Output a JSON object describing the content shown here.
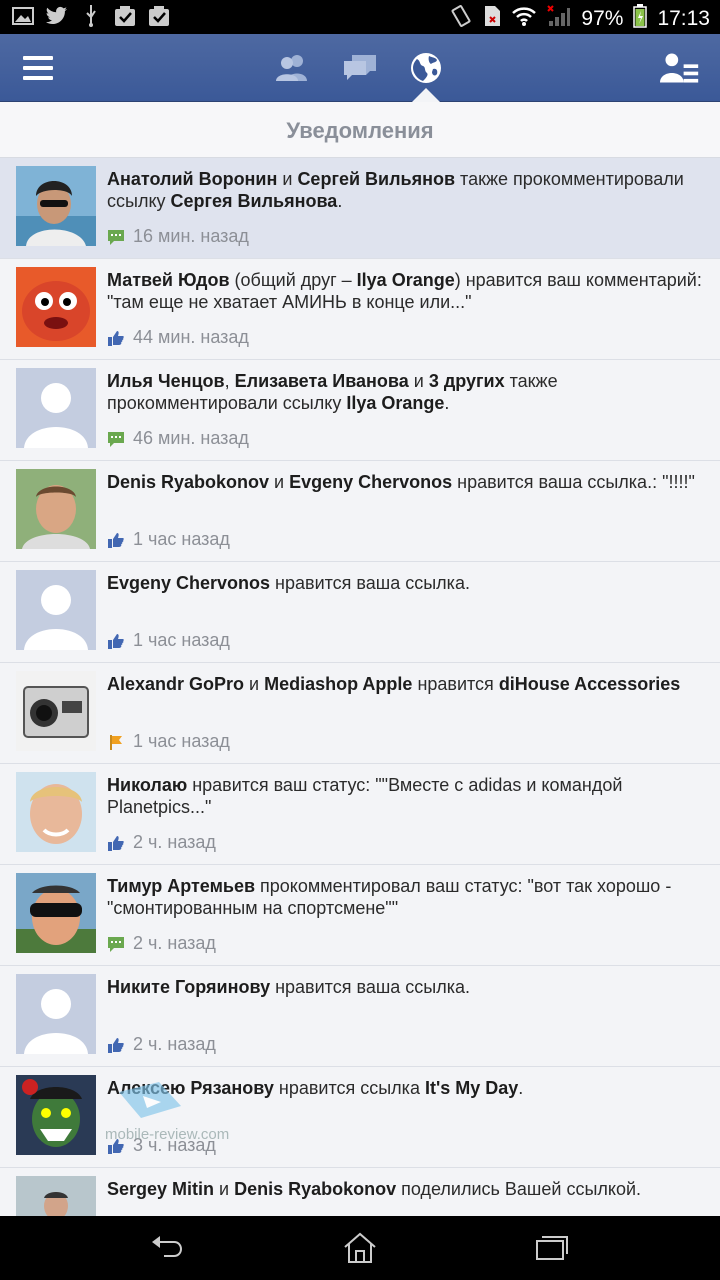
{
  "status_bar": {
    "battery": "97%",
    "time": "17:13"
  },
  "header": {
    "icons": [
      "menu-icon",
      "friends-icon",
      "messages-icon",
      "globe-icon",
      "profile-list-icon"
    ]
  },
  "panel": {
    "title": "Уведомления"
  },
  "notifications": [
    {
      "t1": "Анатолий Воронин",
      "t2": " и ",
      "t3": "Сергей Вильянов",
      "t4": " также прокомментировали ссылку ",
      "t5": "Сергея Вильянова",
      "t6": ".",
      "time": "16 мин. назад",
      "icon": "comment"
    },
    {
      "t1": "Матвей Юдов",
      "t2": " (общий друг – ",
      "t3": "Ilya Orange",
      "t4": ") нравится ваш комментарий: \"там еще не хватает АМИНЬ в конце или...\"",
      "t5": "",
      "t6": "",
      "time": "44 мин. назад",
      "icon": "like"
    },
    {
      "t1": "Илья Ченцов",
      "t2": ", ",
      "t3": "Елизавета Иванова",
      "t4": " и ",
      "t5": "3 других",
      "t6": " также прокомментировали ссылку ",
      "t7": "Ilya Orange",
      "t8": ".",
      "time": "46 мин. назад",
      "icon": "comment"
    },
    {
      "t1": "Denis Ryabokonov",
      "t2": " и ",
      "t3": "Evgeny Chervonos",
      "t4": " нравится ваша ссылка.: \"!!!!\"",
      "t5": "",
      "t6": "",
      "time": "1 час назад",
      "icon": "like"
    },
    {
      "t1": "Evgeny Chervonos",
      "t2": " нравится ваша ссылка.",
      "t3": "",
      "t4": "",
      "t5": "",
      "t6": "",
      "time": "1 час назад",
      "icon": "like"
    },
    {
      "t1": "Alexandr GoPro",
      "t2": " и ",
      "t3": "Mediashop Apple",
      "t4": " нравится ",
      "t5": "diHouse Accessories",
      "t6": "",
      "time": "1 час назад",
      "icon": "flag"
    },
    {
      "t1": "Николаю",
      "t2": " нравится ваш статус: \"\"Вместе с adidas и командой Planetpics...\"",
      "t3": "",
      "t4": "",
      "t5": "",
      "t6": "",
      "time": "2 ч. назад",
      "icon": "like"
    },
    {
      "t1": "Тимур Артемьев",
      "t2": " прокомментировал ваш статус: \"вот так хорошо - \"смонтированным на спортсмене\"\"",
      "t3": "",
      "t4": "",
      "t5": "",
      "t6": "",
      "time": "2 ч. назад",
      "icon": "comment"
    },
    {
      "t1": "Никите Горяинову",
      "t2": " нравится ваша ссылка.",
      "t3": "",
      "t4": "",
      "t5": "",
      "t6": "",
      "time": "2 ч. назад",
      "icon": "like"
    },
    {
      "t1": "Алексею Рязанову",
      "t2": " нравится ссылка ",
      "t3": "It's My Day",
      "t4": ".",
      "t5": "",
      "t6": "",
      "time": "3 ч. назад",
      "icon": "like"
    },
    {
      "t1": "Sergey Mitin",
      "t2": " и ",
      "t3": "Denis Ryabokonov",
      "t4": " поделились Вашей ссылкой.",
      "t5": "",
      "t6": "",
      "time": "",
      "icon": "share"
    }
  ],
  "watermark": "mobile-review.com",
  "nav": {
    "icons": [
      "back-icon",
      "home-icon",
      "recents-icon"
    ]
  }
}
